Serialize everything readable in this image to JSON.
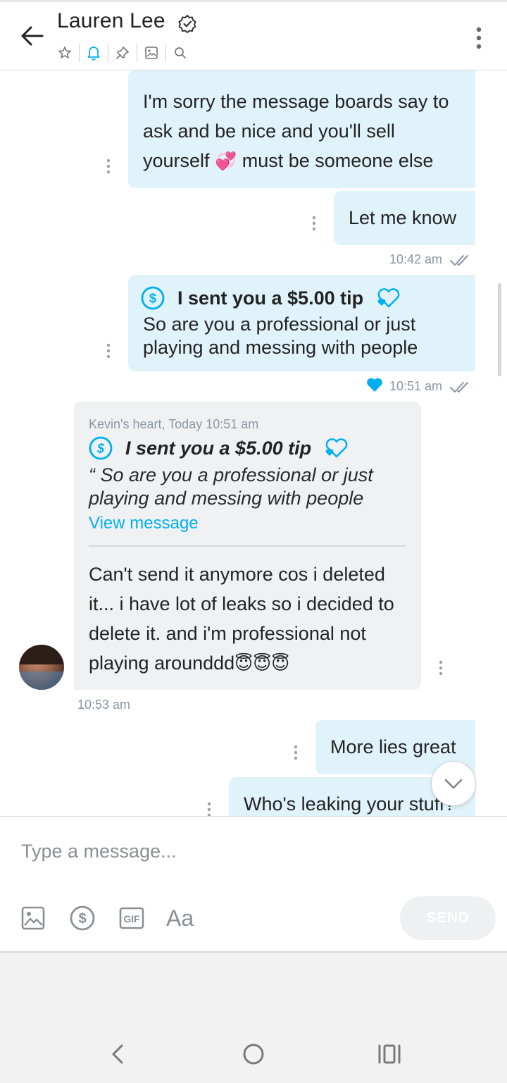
{
  "header": {
    "title": "Lauren Lee",
    "icons": [
      "back-arrow-icon",
      "verified-icon",
      "star-icon",
      "bell-icon",
      "pin-icon",
      "image-icon",
      "search-icon",
      "more-vertical-icon"
    ],
    "accent_color": "#00aff0"
  },
  "messages": {
    "m1": {
      "line1": "I'm sorry the message boards say to",
      "line2": "ask and be nice and you'll sell",
      "line3a": "yourself",
      "emoji": "💞",
      "line3b": "must be someone else"
    },
    "m2": {
      "text": "Let me know",
      "time": "10:42 am"
    },
    "m3": {
      "tip": "I sent you a $5.00 tip",
      "line1": "So are you a professional or just",
      "line2": "playing and messing with people",
      "time": "10:51 am"
    },
    "m4": {
      "quote_header": "Kevin's heart, Today 10:51 am",
      "quote_tip": "I sent you a $5.00 tip",
      "quote_line1": "“ So are you a professional or just",
      "quote_line2": "playing and messing with people",
      "view_link": "View message",
      "line1": "Can't send it anymore cos i deleted",
      "line2": "it... i have lot of leaks so i decided to",
      "line3": "delete it. and i'm professional not",
      "line4": "playing arounddd",
      "emojis": "😇😇😇",
      "time": "10:53 am"
    },
    "m5": {
      "text": "More lies great"
    },
    "m6": {
      "text": "Who's leaking your stuff?"
    }
  },
  "composer": {
    "placeholder": "Type a message...",
    "send_label": "SEND",
    "tools": [
      "image-icon",
      "dollar-icon",
      "gif-icon",
      "text-format-icon"
    ],
    "text_tool_label": "Aa"
  }
}
